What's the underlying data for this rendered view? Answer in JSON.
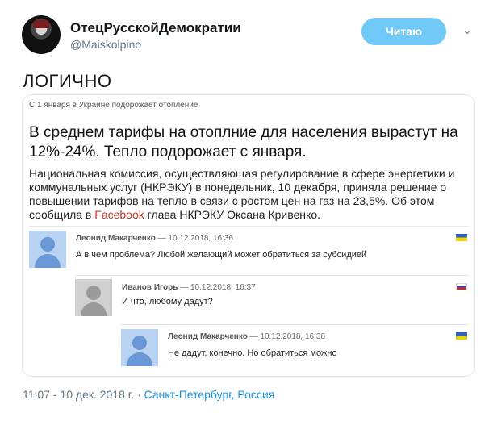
{
  "author": {
    "name": "ОтецРусскойДемократии",
    "handle": "@Maiskolpino",
    "follow_label": "Читаю"
  },
  "tweet": {
    "text": "ЛОГИЧНО",
    "time": "11:07 - 10 дек. 2018 г.",
    "separator": "·",
    "location": "Санкт-Петербург, Россия"
  },
  "card": {
    "kicker": "С 1 января в Украине подорожает отопление",
    "headline": "В среднем тарифы на отоплние для населения вырастут на 12%-24%. Тепло подорожает с января.",
    "body_before_link": "Национальная комиссия, осуществляющая регулирование в сфере энергетики и коммунальных услуг (НКРЭКУ) в понедельник, 10 декабря, приняла решение о повышении тарифов на тепло в связи с ростом цен на газ на 23,5%. Об этом сообщила в ",
    "body_link": "Facebook",
    "body_after_link": " глава НКРЭКУ Оксана Кривенко.",
    "comments": [
      {
        "name": "Леонид Макарченко",
        "date": "— 10.12.2018, 16:36",
        "text": "А в чем проблема? Любой желающий может обратиться за субсидией",
        "flag": "ukraine-flag-icon"
      },
      {
        "name": "Иванов Игорь",
        "date": "— 10.12.2018, 16:37",
        "text": "И что, любому дадут?",
        "flag": "russia-flag-icon"
      },
      {
        "name": "Леонид Макарченко",
        "date": "— 10.12.2018, 16:38",
        "text": "Не дадут, конечно. Но обратиться можно",
        "flag": "ukraine-flag-icon"
      }
    ]
  },
  "colors": {
    "follow_button": "#71c9f8",
    "link": "#1b95e0",
    "handle_gray": "#657786"
  }
}
